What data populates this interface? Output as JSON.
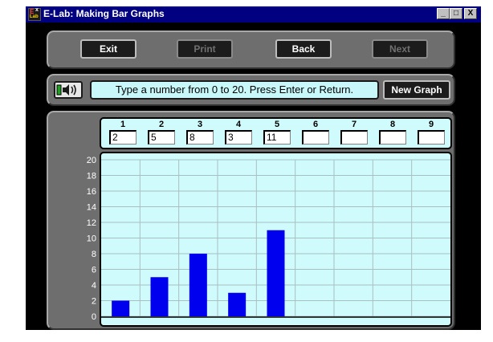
{
  "window": {
    "title": "E-Lab: Making  Bar Graphs",
    "icon": "elab-app-icon",
    "minimize_label": "_",
    "maximize_label": "□",
    "close_label": "X"
  },
  "nav": {
    "exit_label": "Exit",
    "print_label": "Print",
    "back_label": "Back",
    "next_label": "Next"
  },
  "message": {
    "sound_icon": "speaker-icon",
    "prompt": "Type a number from 0 to 20. Press Enter or Return.",
    "new_graph_label": "New Graph"
  },
  "inputs": [
    {
      "label": "1",
      "value": "2"
    },
    {
      "label": "2",
      "value": "5"
    },
    {
      "label": "3",
      "value": "8"
    },
    {
      "label": "4",
      "value": "3"
    },
    {
      "label": "5",
      "value": "11"
    },
    {
      "label": "6",
      "value": ""
    },
    {
      "label": "7",
      "value": ""
    },
    {
      "label": "8",
      "value": ""
    },
    {
      "label": "9",
      "value": ""
    }
  ],
  "colors": {
    "bar": "#0000ee",
    "grid": "#a9bfc2",
    "chart_bg": "#d0fbfc",
    "panel": "#6e6e6e",
    "titlebar": "#000080"
  },
  "chart_data": {
    "type": "bar",
    "categories": [
      "1",
      "2",
      "3",
      "4",
      "5",
      "6",
      "7",
      "8",
      "9"
    ],
    "values": [
      2,
      5,
      8,
      3,
      11,
      null,
      null,
      null,
      null
    ],
    "yticks": [
      "0",
      "2",
      "4",
      "6",
      "8",
      "10",
      "12",
      "14",
      "16",
      "18",
      "20"
    ],
    "ylim": [
      0,
      20
    ],
    "ystep": 2,
    "grid": true,
    "legend": "none"
  }
}
